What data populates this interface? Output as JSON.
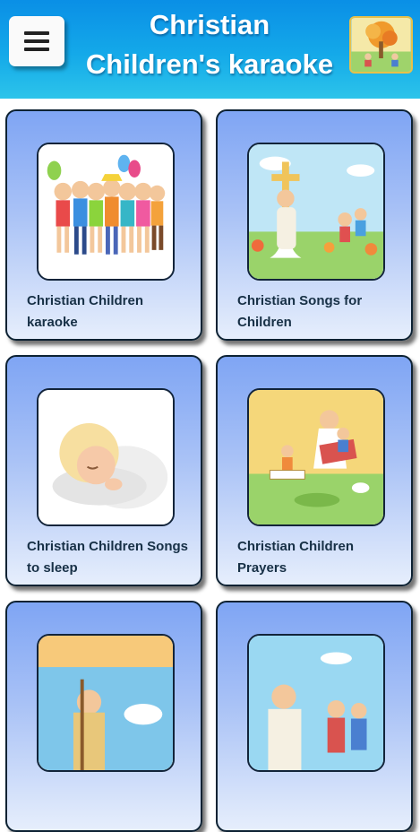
{
  "header": {
    "title_line1": "Christian",
    "title_line2": "Children's karaoke"
  },
  "menu": {
    "icon": "hamburger-menu-icon"
  },
  "cards": [
    {
      "label": "Christian Children karaoke",
      "image": "children-group-illustration"
    },
    {
      "label": "Christian Songs for Children",
      "image": "jesus-with-children-illustration"
    },
    {
      "label": "Christian Children Songs to sleep",
      "image": "sleeping-baby-illustration"
    },
    {
      "label": "Christian Children Prayers",
      "image": "jesus-reading-to-children-illustration"
    },
    {
      "label": "",
      "image": "bible-scene-illustration"
    },
    {
      "label": "",
      "image": "jesus-with-lamb-illustration"
    }
  ],
  "colors": {
    "header_top": "#0a8fe6",
    "header_bottom": "#2cc4ea",
    "card_top": "#7fa5f4",
    "card_bottom": "#e6eefc",
    "card_border": "#0d2233",
    "label_text": "#173046"
  }
}
